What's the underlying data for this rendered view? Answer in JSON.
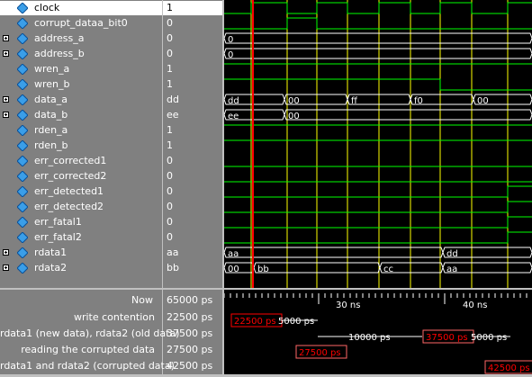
{
  "signals": [
    {
      "name": "clock",
      "value": "1",
      "expandable": false,
      "selected": true
    },
    {
      "name": "corrupt_dataa_bit0",
      "value": "0",
      "expandable": false
    },
    {
      "name": "address_a",
      "value": "0",
      "expandable": true
    },
    {
      "name": "address_b",
      "value": "0",
      "expandable": true
    },
    {
      "name": "wren_a",
      "value": "1",
      "expandable": false
    },
    {
      "name": "wren_b",
      "value": "1",
      "expandable": false
    },
    {
      "name": "data_a",
      "value": "dd",
      "expandable": true
    },
    {
      "name": "data_b",
      "value": "ee",
      "expandable": true
    },
    {
      "name": "rden_a",
      "value": "1",
      "expandable": false
    },
    {
      "name": "rden_b",
      "value": "1",
      "expandable": false
    },
    {
      "name": "err_corrected1",
      "value": "0",
      "expandable": false
    },
    {
      "name": "err_corrected2",
      "value": "0",
      "expandable": false
    },
    {
      "name": "err_detected1",
      "value": "0",
      "expandable": false
    },
    {
      "name": "err_detected2",
      "value": "0",
      "expandable": false
    },
    {
      "name": "err_fatal1",
      "value": "0",
      "expandable": false
    },
    {
      "name": "err_fatal2",
      "value": "0",
      "expandable": false
    },
    {
      "name": "rdata1",
      "value": "aa",
      "expandable": true
    },
    {
      "name": "rdata2",
      "value": "bb",
      "expandable": true
    }
  ],
  "now": {
    "label": "Now",
    "value": "65000 ps"
  },
  "timeline": {
    "ticks": [
      "30 ns",
      "40 ns"
    ]
  },
  "cursors": [
    {
      "name": "write contention",
      "value": "22500 ps"
    },
    {
      "name": "rdata1 (new data), rdata2 (old data)",
      "value": "37500 ps"
    },
    {
      "name": "reading the corrupted data",
      "value": "27500 ps"
    },
    {
      "name": "rdata1 and rdata2 (corrupted data)",
      "value": "42500 ps"
    }
  ],
  "bus_values": {
    "address_a": [
      "0"
    ],
    "address_b": [
      "0"
    ],
    "data_a": [
      "dd",
      "00",
      "ff",
      "f0",
      "00"
    ],
    "data_b": [
      "ee",
      "00"
    ],
    "rdata1": [
      "aa",
      "dd"
    ],
    "rdata2": [
      "00",
      "bb",
      "cc",
      "aa"
    ]
  },
  "cursor_marks": {
    "c1": [
      "22500 ps",
      "5000 ps"
    ],
    "c2": [
      "10000 ps",
      "37500 ps",
      "5000 ps"
    ],
    "c3": [
      "27500 ps"
    ],
    "c4": [
      "42500 ps"
    ]
  },
  "colors": {
    "wave": "#00ff00",
    "bus": "#ffffff",
    "cursor": "#ffff00",
    "active_cursor": "#ff0000",
    "grid_bg": "#000000",
    "panel": "#808080"
  }
}
